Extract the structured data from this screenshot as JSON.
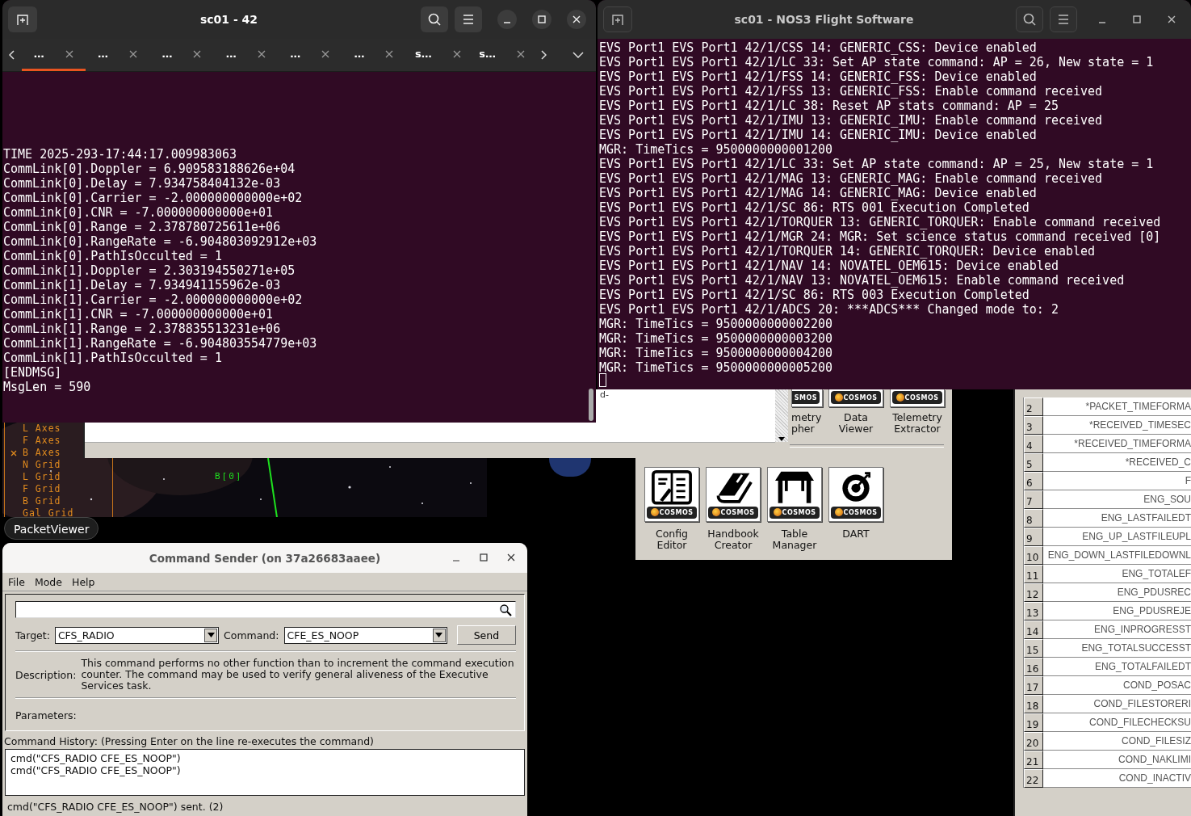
{
  "terminal_left": {
    "title": "sc01 - 42",
    "tabs": [
      {
        "label": "…",
        "selected": true
      },
      {
        "label": "…",
        "selected": false
      },
      {
        "label": "…",
        "selected": false
      },
      {
        "label": "…",
        "selected": false
      },
      {
        "label": "…",
        "selected": false
      },
      {
        "label": "…",
        "selected": false
      },
      {
        "label": "s…",
        "selected": false
      },
      {
        "label": "s…",
        "selected": false
      }
    ],
    "lines": [
      "TIME 2025-293-17:44:17.009983063",
      "CommLink[0].Doppler = 6.909583188626e+04",
      "CommLink[0].Delay = 7.934758404132e-03",
      "CommLink[0].Carrier = -2.000000000000e+02",
      "CommLink[0].CNR = -7.000000000000e+01",
      "CommLink[0].Range = 2.378780725611e+06",
      "CommLink[0].RangeRate = -6.904803092912e+03",
      "CommLink[0].PathIsOcculted = 1",
      "CommLink[1].Doppler = 2.303194550271e+05",
      "CommLink[1].Delay = 7.934941155962e-03",
      "CommLink[1].Carrier = -2.000000000000e+02",
      "CommLink[1].CNR = -7.000000000000e+01",
      "CommLink[1].Range = 2.378835513231e+06",
      "CommLink[1].RangeRate = -6.904803554779e+03",
      "CommLink[1].PathIsOcculted = 1",
      "[ENDMSG]",
      "MsgLen = 590"
    ]
  },
  "terminal_right": {
    "title": "sc01 - NOS3 Flight Software",
    "lines": [
      "EVS Port1 EVS Port1 42/1/CSS 14: GENERIC_CSS: Device enabled",
      "EVS Port1 EVS Port1 42/1/LC 33: Set AP state command: AP = 26, New state = 1",
      "EVS Port1 EVS Port1 42/1/FSS 14: GENERIC_FSS: Device enabled",
      "EVS Port1 EVS Port1 42/1/FSS 13: GENERIC_FSS: Enable command received",
      "EVS Port1 EVS Port1 42/1/LC 38: Reset AP stats command: AP = 25",
      "EVS Port1 EVS Port1 42/1/IMU 13: GENERIC_IMU: Enable command received",
      "EVS Port1 EVS Port1 42/1/IMU 14: GENERIC_IMU: Device enabled",
      "MGR: TimeTics = 9500000000001200",
      "EVS Port1 EVS Port1 42/1/LC 33: Set AP state command: AP = 25, New state = 1",
      "EVS Port1 EVS Port1 42/1/MAG 13: GENERIC_MAG: Enable command received",
      "EVS Port1 EVS Port1 42/1/MAG 14: GENERIC_MAG: Device enabled",
      "EVS Port1 EVS Port1 42/1/SC 86: RTS 001 Execution Completed",
      "EVS Port1 EVS Port1 42/1/TORQUER 13: GENERIC_TORQUER: Enable command received",
      "EVS Port1 EVS Port1 42/1/MGR 24: MGR: Set science status command received [0]",
      "EVS Port1 EVS Port1 42/1/TORQUER 14: GENERIC_TORQUER: Device enabled",
      "EVS Port1 EVS Port1 42/1/NAV 14: NOVATEL_OEM615: Device enabled",
      "EVS Port1 EVS Port1 42/1/NAV 13: NOVATEL_OEM615: Enable command received",
      "EVS Port1 EVS Port1 42/1/SC 86: RTS 003 Execution Completed",
      "EVS Port1 EVS Port1 42/1/ADCS 20: ***ADCS*** Changed mode to: 2",
      "MGR: TimeTics = 9500000000002200",
      "MGR: TimeTics = 9500000000003200",
      "MGR: TimeTics = 9500000000004200",
      "MGR: TimeTics = 9500000000005200"
    ]
  },
  "sky_view": {
    "menu": [
      {
        "label": "L Axes",
        "checked": false
      },
      {
        "label": "F Axes",
        "checked": false
      },
      {
        "label": "B Axes",
        "checked": true
      },
      {
        "label": "N Grid",
        "checked": false
      },
      {
        "label": "L Grid",
        "checked": false
      },
      {
        "label": "F Grid",
        "checked": false
      },
      {
        "label": "B Grid",
        "checked": false
      },
      {
        "label": "Gal Grid",
        "checked": false
      }
    ],
    "body_label": "B[0]"
  },
  "text_window": {
    "text": "d-"
  },
  "launcher": {
    "top_row": [
      {
        "badge": "SMOS",
        "label": "metry\npher"
      },
      {
        "badge": "COSMOS",
        "label": "Data\nViewer"
      },
      {
        "badge": "COSMOS",
        "label": "Telemetry\nExtractor"
      }
    ],
    "utilities": [
      {
        "kind": "config",
        "badge": "COSMOS",
        "label": "Config\nEditor"
      },
      {
        "kind": "book",
        "badge": "COSMOS",
        "label": "Handbook\nCreator"
      },
      {
        "kind": "table",
        "badge": "COSMOS",
        "label": "Table\nManager"
      },
      {
        "kind": "target",
        "badge": "COSMOS",
        "label": "DART"
      }
    ]
  },
  "table": {
    "rows": [
      {
        "number": "2",
        "value": "*PACKET_TIMEFORMA"
      },
      {
        "number": "3",
        "value": "*RECEIVED_TIMESEC"
      },
      {
        "number": "4",
        "value": "*RECEIVED_TIMEFORMA"
      },
      {
        "number": "5",
        "value": "*RECEIVED_C"
      },
      {
        "number": "6",
        "value": "F"
      },
      {
        "number": "7",
        "value": "ENG_SOU"
      },
      {
        "number": "8",
        "value": "ENG_LASTFAILEDT"
      },
      {
        "number": "9",
        "value": "ENG_UP_LASTFILEUPL"
      },
      {
        "number": "10",
        "value": "ENG_DOWN_LASTFILEDOWNL"
      },
      {
        "number": "11",
        "value": "ENG_TOTALEF"
      },
      {
        "number": "12",
        "value": "ENG_PDUSREC"
      },
      {
        "number": "13",
        "value": "ENG_PDUSREJE"
      },
      {
        "number": "14",
        "value": "ENG_INPROGRESST"
      },
      {
        "number": "15",
        "value": "ENG_TOTALSUCCESST"
      },
      {
        "number": "16",
        "value": "ENG_TOTALFAILEDT"
      },
      {
        "number": "17",
        "value": "COND_POSAC"
      },
      {
        "number": "18",
        "value": "COND_FILESTORERI"
      },
      {
        "number": "19",
        "value": "COND_FILECHECKSU"
      },
      {
        "number": "20",
        "value": "COND_FILESIZ"
      },
      {
        "number": "21",
        "value": "COND_NAKLIMI"
      },
      {
        "number": "22",
        "value": "COND_INACTIV"
      }
    ]
  },
  "window_label": "PacketViewer",
  "command_sender": {
    "title": "Command Sender (on 37a26683aaee)",
    "menus": [
      "File",
      "Mode",
      "Help"
    ],
    "target_label": "Target:",
    "target": "CFS_RADIO",
    "command_label": "Command:",
    "command": "CFE_ES_NOOP",
    "send": "Send",
    "description_label": "Description:",
    "description": "This command performs no other function than to increment the command execution counter. The command may be used to verify general aliveness of the Executive Services task.",
    "parameters_label": "Parameters:",
    "history_label": "Command History: (Pressing Enter on the line re-executes the command)",
    "history": [
      "cmd(\"CFS_RADIO CFE_ES_NOOP\")",
      "cmd(\"CFS_RADIO CFE_ES_NOOP\")"
    ],
    "status": "cmd(\"CFS_RADIO CFE_ES_NOOP\") sent. (2)"
  }
}
